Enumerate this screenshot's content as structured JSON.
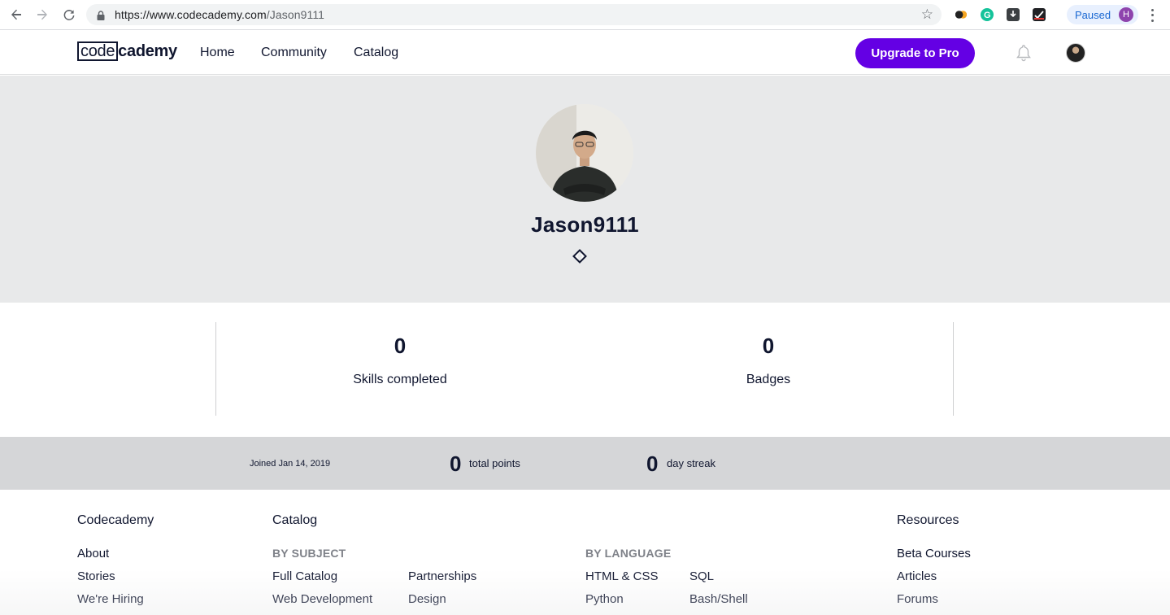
{
  "browser": {
    "url_domain": "https://www.codecademy.com",
    "url_path": "/Jason9111",
    "paused_label": "Paused",
    "profile_initial": "H"
  },
  "header": {
    "logo_boxed": "code",
    "logo_rest": "cademy",
    "nav": [
      "Home",
      "Community",
      "Catalog"
    ],
    "upgrade_label": "Upgrade to Pro",
    "accent_color": "#6400e4"
  },
  "profile": {
    "username": "Jason9111"
  },
  "stats": {
    "skills_completed_value": "0",
    "skills_completed_label": "Skills completed",
    "badges_value": "0",
    "badges_label": "Badges"
  },
  "summary": {
    "joined": "Joined Jan 14, 2019",
    "total_points_value": "0",
    "total_points_label": "total points",
    "day_streak_value": "0",
    "day_streak_label": "day streak"
  },
  "footer": {
    "codecademy": {
      "heading": "Codecademy",
      "links": [
        "About",
        "Stories",
        "We're Hiring"
      ]
    },
    "catalog": {
      "heading": "Catalog",
      "by_subject_label": "BY SUBJECT",
      "subject_col1": [
        "Full Catalog",
        "Web Development"
      ],
      "subject_col2": [
        "Partnerships",
        "Design"
      ],
      "by_language_label": "BY LANGUAGE",
      "language_col1": [
        "HTML & CSS",
        "Python"
      ],
      "language_col2": [
        "SQL",
        "Bash/Shell"
      ]
    },
    "resources": {
      "heading": "Resources",
      "links": [
        "Beta Courses",
        "Articles",
        "Forums"
      ]
    }
  }
}
